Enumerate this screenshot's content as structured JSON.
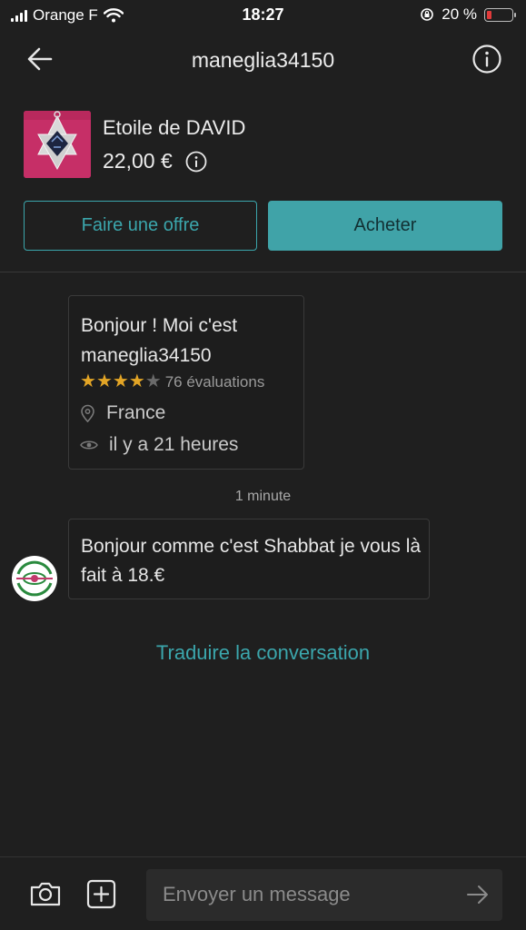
{
  "status_bar": {
    "carrier": "Orange F",
    "time": "18:27",
    "battery_text": "20 %",
    "battery_level": 0.2,
    "battery_color": "#e03a3a"
  },
  "nav": {
    "title": "maneglia34150",
    "back_icon": "arrow-left-icon",
    "info_icon": "info-circle-icon"
  },
  "product": {
    "title": "Etoile de DAVID",
    "price": "22,00 €"
  },
  "actions": {
    "offer_label": "Faire une offre",
    "buy_label": "Acheter",
    "accent_color": "#3ba6ac"
  },
  "seller_card": {
    "greeting": "Bonjour ! Moi c'est maneglia34150",
    "rating_stars": 4,
    "rating_max": 5,
    "reviews": "76 évaluations",
    "location": "France",
    "last_seen": "il y a 21 heures"
  },
  "chat": {
    "timestamp": "1 minute",
    "message": "Bonjour comme c'est Shabbat je vous là fait à 18.€"
  },
  "translate_label": "Traduire la conversation",
  "composer": {
    "placeholder": "Envoyer un message",
    "camera_icon": "camera-icon",
    "add_icon": "plus-square-icon",
    "send_icon": "arrow-right-icon"
  }
}
